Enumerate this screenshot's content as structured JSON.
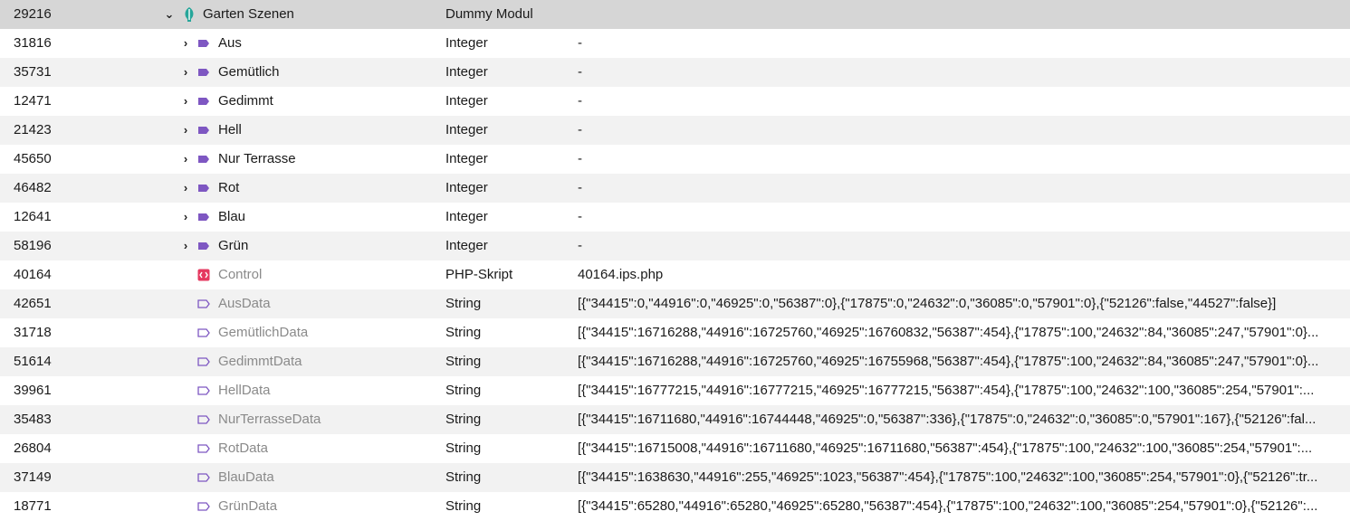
{
  "colors": {
    "header_bg": "#d6d6d6",
    "row_alt_bg": "#f2f2f2",
    "variable_icon": "#7e57c2",
    "script_icon": "#e53960",
    "module_icon": "#26a69a"
  },
  "root": {
    "id": "29216",
    "name": "Garten Szenen",
    "type": "Dummy Modul",
    "icon": "leaf-module-icon"
  },
  "rows": [
    {
      "id": "31816",
      "name": "Aus",
      "type": "Integer",
      "value": "-"
    },
    {
      "id": "35731",
      "name": "Gemütlich",
      "type": "Integer",
      "value": "-"
    },
    {
      "id": "12471",
      "name": "Gedimmt",
      "type": "Integer",
      "value": "-"
    },
    {
      "id": "21423",
      "name": "Hell",
      "type": "Integer",
      "value": "-"
    },
    {
      "id": "45650",
      "name": "Nur Terrasse",
      "type": "Integer",
      "value": "-"
    },
    {
      "id": "46482",
      "name": "Rot",
      "type": "Integer",
      "value": "-"
    },
    {
      "id": "12641",
      "name": "Blau",
      "type": "Integer",
      "value": "-"
    },
    {
      "id": "58196",
      "name": "Grün",
      "type": "Integer",
      "value": "-"
    },
    {
      "id": "40164",
      "name": "Control",
      "type": "PHP-Skript",
      "value": "40164.ips.php"
    },
    {
      "id": "42651",
      "name": "AusData",
      "type": "String",
      "value": "[{\"34415\":0,\"44916\":0,\"46925\":0,\"56387\":0},{\"17875\":0,\"24632\":0,\"36085\":0,\"57901\":0},{\"52126\":false,\"44527\":false}]"
    },
    {
      "id": "31718",
      "name": "GemütlichData",
      "type": "String",
      "value": "[{\"34415\":16716288,\"44916\":16725760,\"46925\":16760832,\"56387\":454},{\"17875\":100,\"24632\":84,\"36085\":247,\"57901\":0}..."
    },
    {
      "id": "51614",
      "name": "GedimmtData",
      "type": "String",
      "value": "[{\"34415\":16716288,\"44916\":16725760,\"46925\":16755968,\"56387\":454},{\"17875\":100,\"24632\":84,\"36085\":247,\"57901\":0}..."
    },
    {
      "id": "39961",
      "name": "HellData",
      "type": "String",
      "value": "[{\"34415\":16777215,\"44916\":16777215,\"46925\":16777215,\"56387\":454},{\"17875\":100,\"24632\":100,\"36085\":254,\"57901\":..."
    },
    {
      "id": "35483",
      "name": "NurTerrasseData",
      "type": "String",
      "value": "[{\"34415\":16711680,\"44916\":16744448,\"46925\":0,\"56387\":336},{\"17875\":0,\"24632\":0,\"36085\":0,\"57901\":167},{\"52126\":fal..."
    },
    {
      "id": "26804",
      "name": "RotData",
      "type": "String",
      "value": "[{\"34415\":16715008,\"44916\":16711680,\"46925\":16711680,\"56387\":454},{\"17875\":100,\"24632\":100,\"36085\":254,\"57901\":..."
    },
    {
      "id": "37149",
      "name": "BlauData",
      "type": "String",
      "value": "[{\"34415\":1638630,\"44916\":255,\"46925\":1023,\"56387\":454},{\"17875\":100,\"24632\":100,\"36085\":254,\"57901\":0},{\"52126\":tr..."
    },
    {
      "id": "18771",
      "name": "GrünData",
      "type": "String",
      "value": "[{\"34415\":65280,\"44916\":65280,\"46925\":65280,\"56387\":454},{\"17875\":100,\"24632\":100,\"36085\":254,\"57901\":0},{\"52126\":..."
    }
  ]
}
